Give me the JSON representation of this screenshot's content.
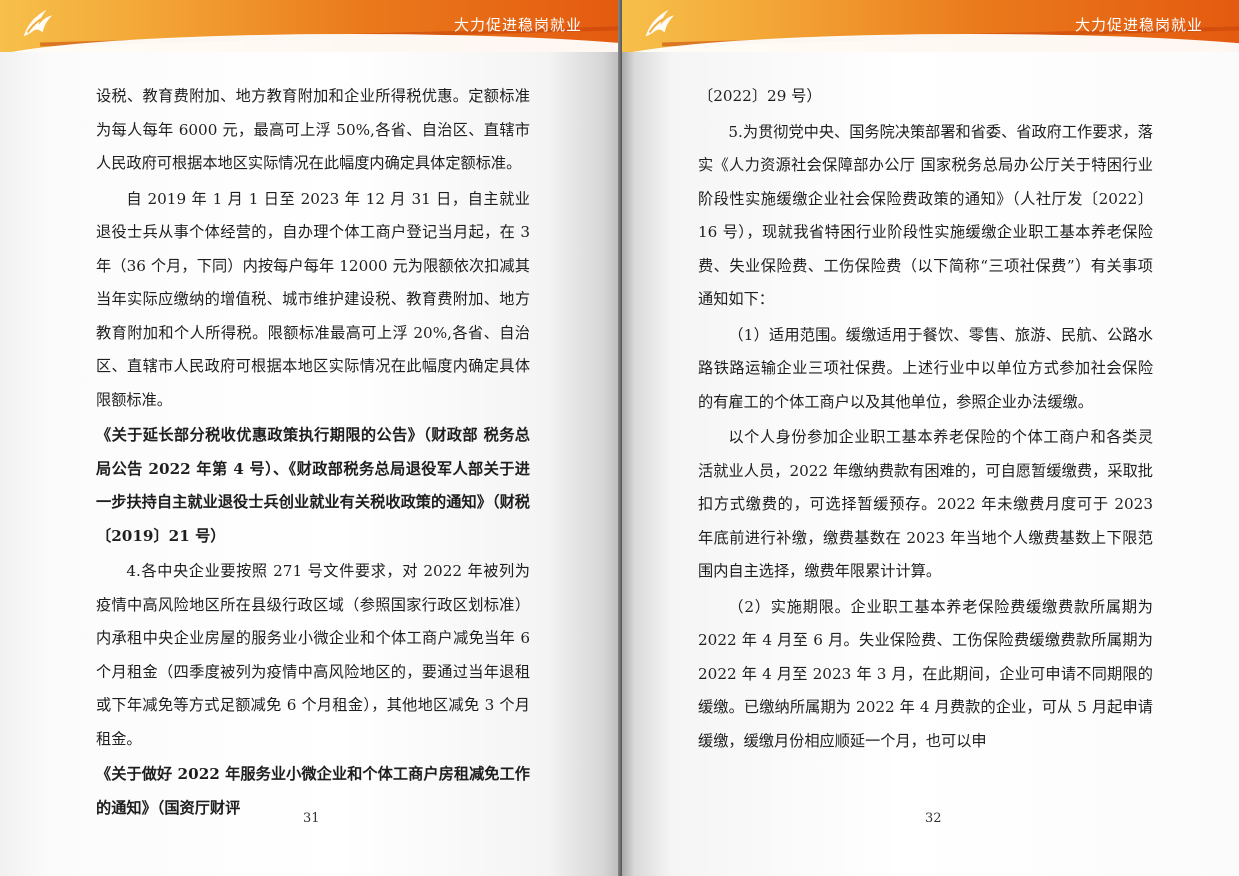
{
  "left_page": {
    "header_title": "大力促进稳岗就业",
    "page_number": "31",
    "paragraphs": [
      "设税、教育费附加、地方教育附加和企业所得税优惠。定额标准为每人每年 6000 元，最高可上浮 50%,各省、自治区、直辖市人民政府可根据本地区实际情况在此幅度内确定具体定额标准。",
      "自 2019 年 1 月 1 日至 2023 年 12 月 31 日，自主就业退役士兵从事个体经营的，自办理个体工商户登记当月起，在 3 年（36 个月，下同）内按每户每年 12000 元为限额依次扣减其当年实际应缴纳的增值税、城市维护建设税、教育费附加、地方教育附加和个人所得税。限额标准最高可上浮 20%,各省、自治区、直辖市人民政府可根据本地区实际情况在此幅度内确定具体限额标准。",
      "《关于延长部分税收优惠政策执行期限的公告》（财政部 税务总局公告 2022 年第 4 号）、《财政部税务总局退役军人部关于进一步扶持自主就业退役士兵创业就业有关税收政策的通知》（财税〔2019〕21 号）",
      "4.各中央企业要按照 271 号文件要求，对 2022 年被列为疫情中高风险地区所在县级行政区域（参照国家行政区划标准）内承租中央企业房屋的服务业小微企业和个体工商户减免当年 6 个月租金（四季度被列为疫情中高风险地区的，要通过当年退租或下年减免等方式足额减免 6 个月租金），其他地区减免 3 个月租金。",
      "《关于做好 2022 年服务业小微企业和个体工商户房租减免工作的通知》（国资厅财评"
    ]
  },
  "right_page": {
    "header_title": "大力促进稳岗就业",
    "page_number": "32",
    "paragraphs": [
      "〔2022〕29 号）",
      "5.为贯彻党中央、国务院决策部署和省委、省政府工作要求，落实《人力资源社会保障部办公厅 国家税务总局办公厅关于特困行业阶段性实施缓缴企业社会保险费政策的通知》（人社厅发〔2022〕16 号），现就我省特困行业阶段性实施缓缴企业职工基本养老保险费、失业保险费、工伤保险费（以下简称“三项社保费”）有关事项通知如下：",
      "（1）适用范围。缓缴适用于餐饮、零售、旅游、民航、公路水路铁路运输企业三项社保费。上述行业中以单位方式参加社会保险的有雇工的个体工商户以及其他单位，参照企业办法缓缴。",
      "以个人身份参加企业职工基本养老保险的个体工商户和各类灵活就业人员，2022 年缴纳费款有困难的，可自愿暂缓缴费，采取批扣方式缴费的，可选择暂缓预存。2022 年未缴费月度可于 2023 年底前进行补缴，缴费基数在 2023 年当地个人缴费基数上下限范围内自主选择，缴费年限累计计算。",
      "（2）实施期限。企业职工基本养老保险费缓缴费款所属期为 2022 年 4 月至 6 月。失业保险费、工伤保险费缓缴费款所属期为 2022 年 4 月至 2023 年 3 月，在此期间，企业可申请不同期限的缓缴。已缴纳所属期为 2022 年 4 月费款的企业，可从 5 月起申请缓缴，缓缴月份相应顺延一个月，也可以申"
    ]
  }
}
